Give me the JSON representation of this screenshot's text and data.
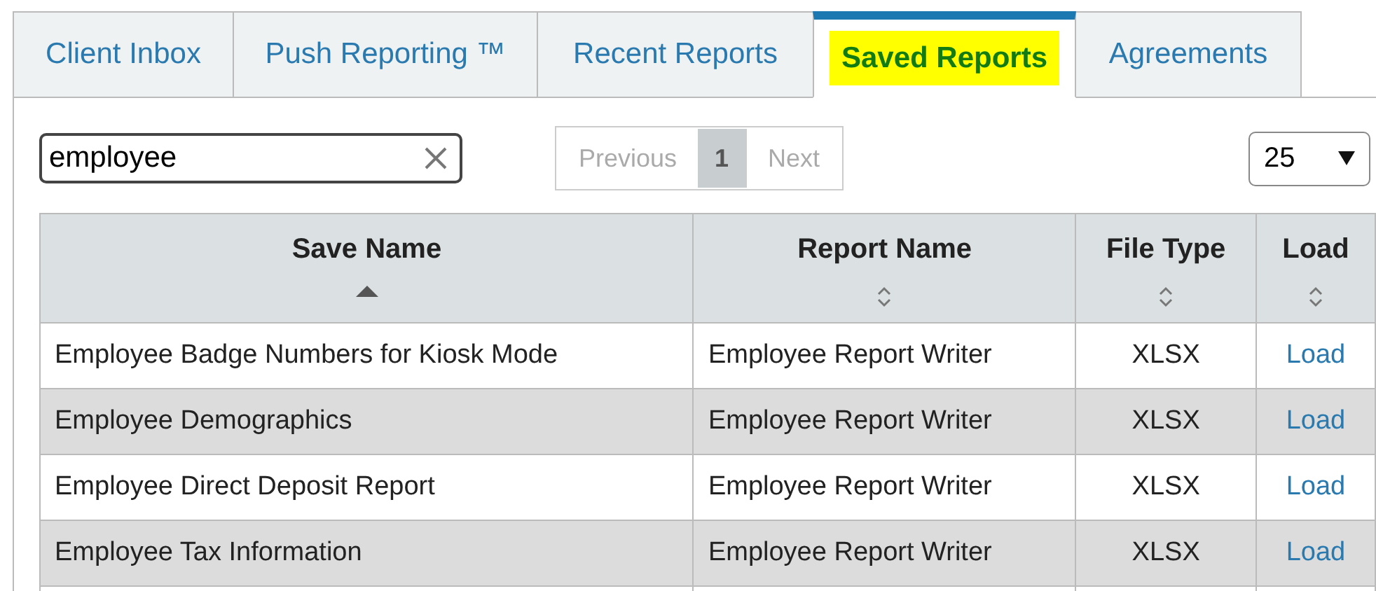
{
  "tabs": [
    {
      "label": "Client Inbox",
      "selected": false,
      "highlighted": false
    },
    {
      "label": "Push Reporting ™",
      "selected": false,
      "highlighted": false
    },
    {
      "label": "Recent Reports",
      "selected": false,
      "highlighted": false
    },
    {
      "label": "Saved Reports",
      "selected": true,
      "highlighted": true
    },
    {
      "label": "Agreements",
      "selected": false,
      "highlighted": false
    }
  ],
  "search": {
    "value": "employee"
  },
  "pagination": {
    "previous": "Previous",
    "pages": [
      {
        "label": "1",
        "selected": true
      }
    ],
    "next": "Next"
  },
  "page_size": {
    "value": "25"
  },
  "table": {
    "columns": [
      {
        "label": "Save Name",
        "sorted": true
      },
      {
        "label": "Report Name",
        "sorted": false
      },
      {
        "label": "File Type",
        "sorted": false
      },
      {
        "label": "Load",
        "sorted": false
      }
    ],
    "rows": [
      [
        "Employee Badge Numbers for Kiosk Mode",
        "Employee Report Writer",
        "XLSX",
        "Load"
      ],
      [
        "Employee Demographics",
        "Employee Report Writer",
        "XLSX",
        "Load"
      ],
      [
        "Employee Direct Deposit Report",
        "Employee Report Writer",
        "XLSX",
        "Load"
      ],
      [
        "Employee Tax Information",
        "Employee Report Writer",
        "XLSX",
        "Load"
      ]
    ]
  }
}
